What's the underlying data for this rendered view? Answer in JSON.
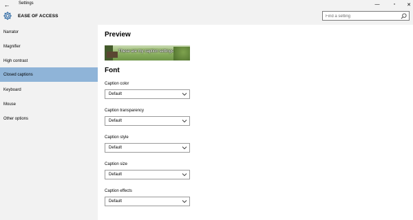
{
  "window": {
    "title": "Settings",
    "back_glyph": "←",
    "controls": {
      "minimize": "—",
      "maximize": "▫",
      "close": "✕"
    }
  },
  "header": {
    "section_title": "EASE OF ACCESS",
    "icon": "gear-icon",
    "search": {
      "placeholder": "Find a setting",
      "value": "",
      "icon": "search-icon"
    }
  },
  "sidebar": {
    "items": [
      {
        "label": "Narrator",
        "active": false
      },
      {
        "label": "Magnifier",
        "active": false
      },
      {
        "label": "High contrast",
        "active": false
      },
      {
        "label": "Closed captions",
        "active": true
      },
      {
        "label": "Keyboard",
        "active": false
      },
      {
        "label": "Mouse",
        "active": false
      },
      {
        "label": "Other options",
        "active": false
      }
    ]
  },
  "main": {
    "preview_heading": "Preview",
    "preview_caption": "These are my caption settings",
    "font_heading": "Font",
    "fields": [
      {
        "label": "Caption color",
        "value": "Default"
      },
      {
        "label": "Caption transparency",
        "value": "Default"
      },
      {
        "label": "Caption style",
        "value": "Default"
      },
      {
        "label": "Caption size",
        "value": "Default"
      },
      {
        "label": "Caption effects",
        "value": "Default"
      }
    ]
  },
  "colors": {
    "accent_selected": "#8fb4d8",
    "chrome": "#f2f2f2"
  }
}
